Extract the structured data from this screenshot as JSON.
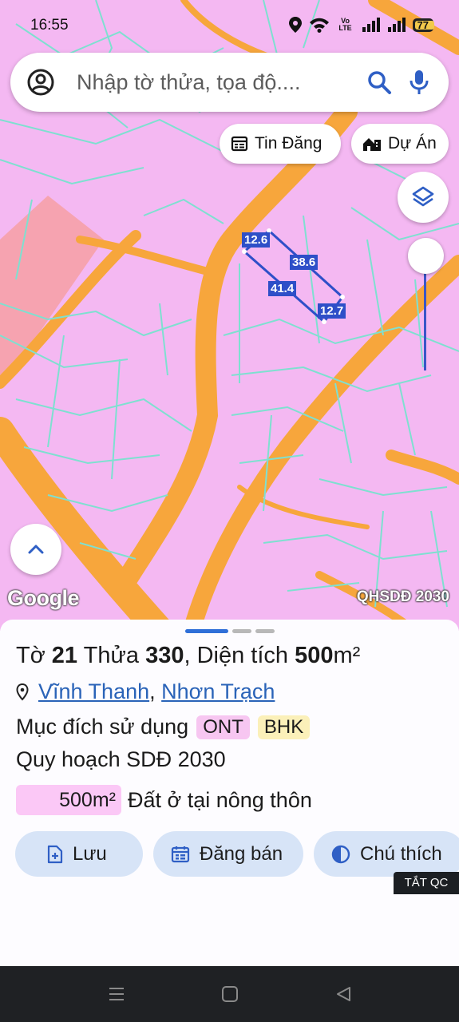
{
  "status_bar": {
    "time": "16:55",
    "network_label": "Vo LTE",
    "battery": "77"
  },
  "search": {
    "placeholder": "Nhập tờ thửa, tọa độ...."
  },
  "chips": {
    "listings": "Tin Đăng",
    "projects": "Dự Án"
  },
  "map": {
    "google_label": "Google",
    "layer_label": "QHSDĐ 2030",
    "parcel_edges": [
      "12.6",
      "38.6",
      "41.4",
      "12.7"
    ],
    "colors": {
      "residential": "#f4b8f2",
      "road": "#f7a63c",
      "boundary": "#7ee0d0",
      "selection": "#2e4fc8",
      "commercial": "#f6a3b0"
    }
  },
  "sheet": {
    "title_prefix": "Tờ",
    "sheet_no": "21",
    "parcel_label": "Thửa",
    "parcel_no": "330",
    "area_label": ", Diện tích",
    "area_value": "500",
    "area_unit": "m²",
    "ward": "Vĩnh Thanh",
    "district": "Nhơn Trạch",
    "purpose_label": "Mục đích sử dụng",
    "purpose_tags": [
      "ONT",
      "BHK"
    ],
    "plan_label": "Quy hoạch SDĐ 2030",
    "plan_area": "500m²",
    "plan_desc": "Đất ở tại nông thôn",
    "actions": {
      "save": "Lưu",
      "sell": "Đăng bán",
      "legend": "Chú thích"
    },
    "ads_off": "TẮT QC"
  }
}
